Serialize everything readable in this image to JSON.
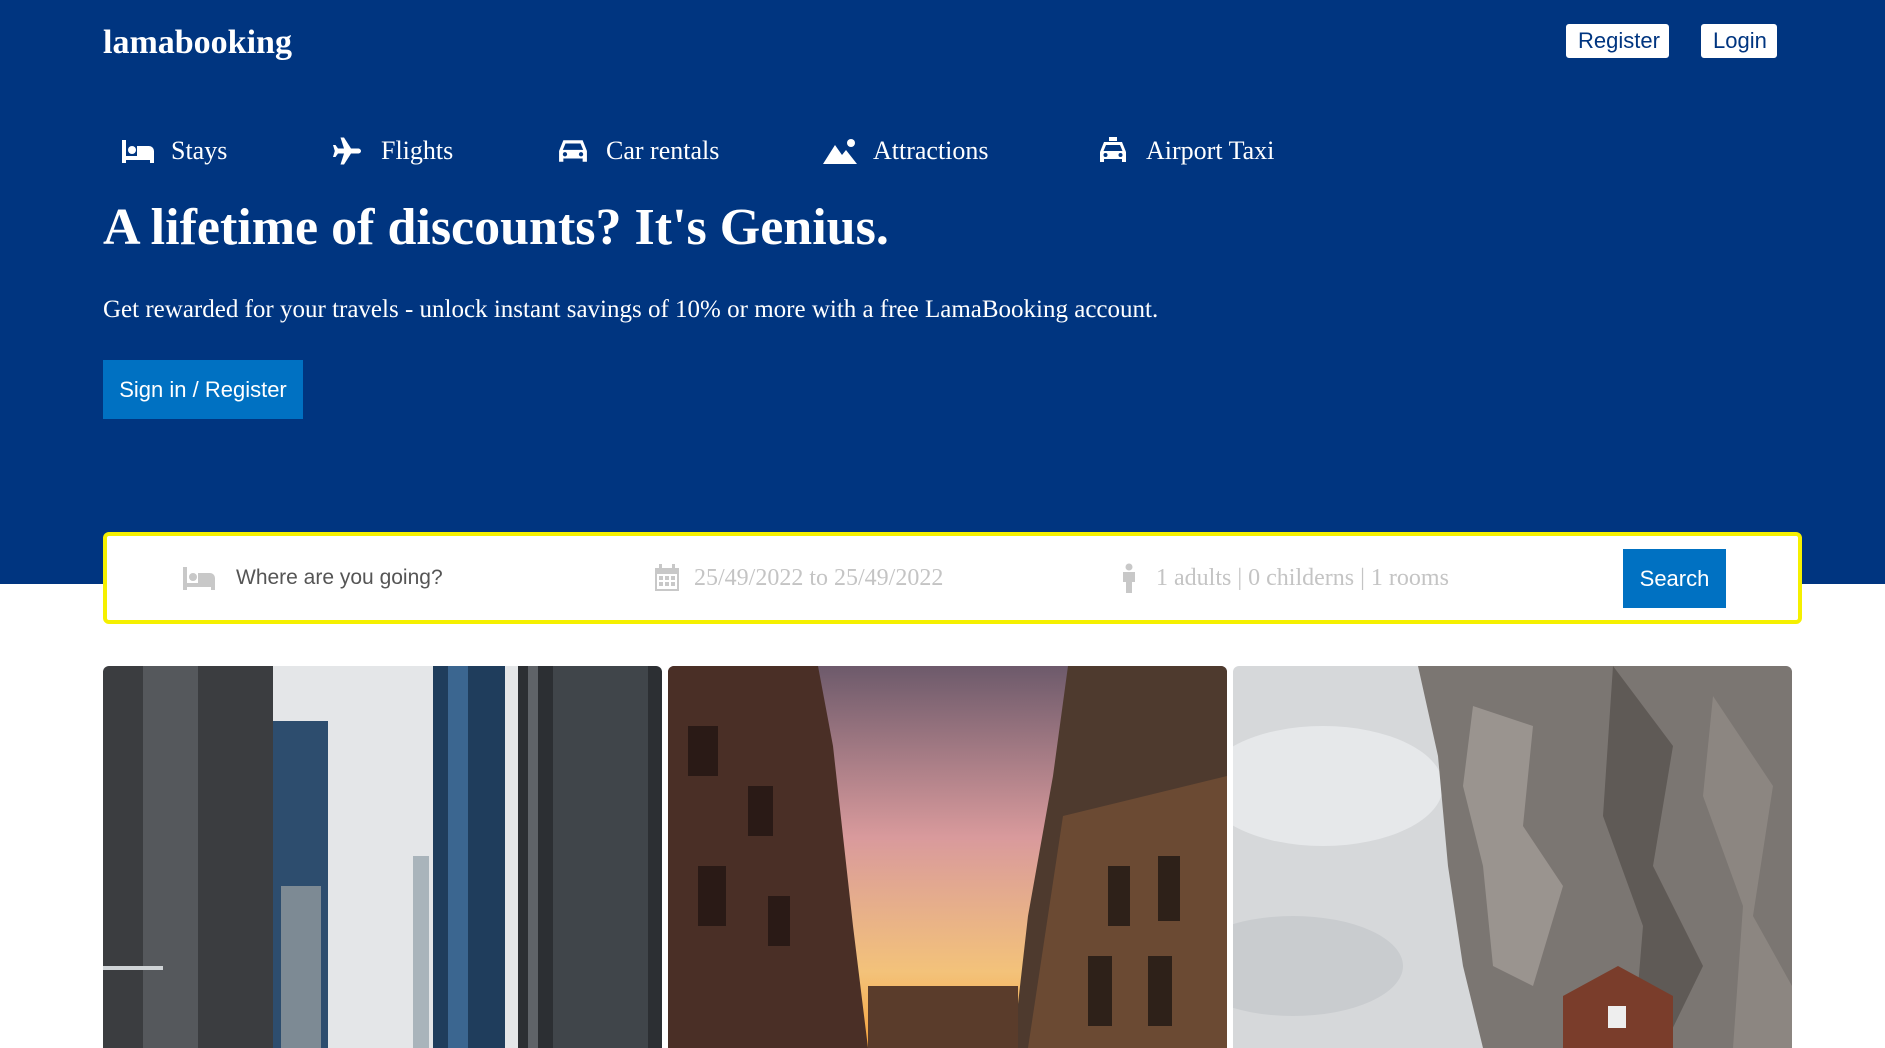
{
  "brand": {
    "logo": "lamabooking"
  },
  "header_buttons": {
    "register": "Register",
    "login": "Login"
  },
  "nav": [
    {
      "label": "Stays",
      "icon": "bed-icon"
    },
    {
      "label": "Flights",
      "icon": "plane-icon"
    },
    {
      "label": "Car rentals",
      "icon": "car-icon"
    },
    {
      "label": "Attractions",
      "icon": "mountain-icon"
    },
    {
      "label": "Airport Taxi",
      "icon": "taxi-icon"
    }
  ],
  "hero": {
    "title": "A lifetime of discounts? It's Genius.",
    "description": "Get rewarded for your travels - unlock instant savings of 10% or more with a free LamaBooking account.",
    "cta": "Sign in / Register"
  },
  "search": {
    "destination_placeholder": "Where are you going?",
    "dates": "25/49/2022 to 25/49/2022",
    "occupancy": "1 adults | 0 childerns | 1 rooms",
    "button": "Search",
    "border_color": "#f5f000"
  },
  "featured": [
    {
      "image": "city-skyscrapers-photo"
    },
    {
      "image": "old-town-sunset-photo"
    },
    {
      "image": "cliff-house-photo"
    }
  ],
  "colors": {
    "header_bg": "#003580",
    "primary_button": "#0071c2",
    "search_border": "#f5f000"
  }
}
